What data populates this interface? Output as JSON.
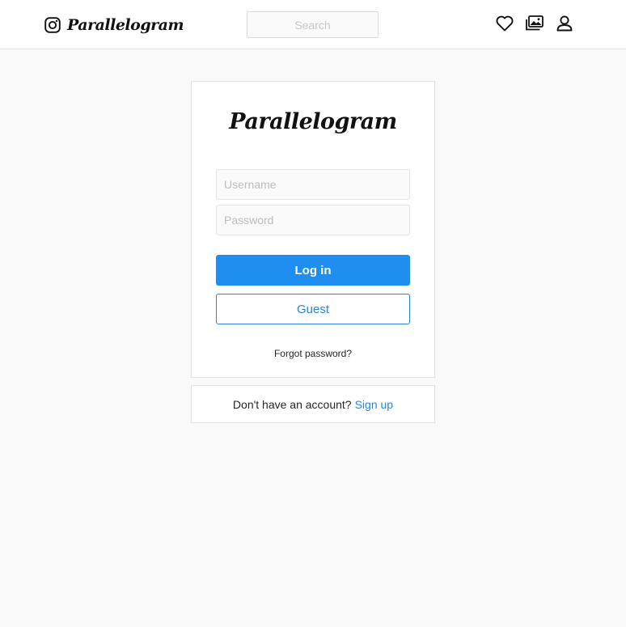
{
  "header": {
    "brand_name": "Parallelogram",
    "search_placeholder": "Search",
    "icons": [
      "camera-icon",
      "heart-icon",
      "photos-icon",
      "user-icon"
    ]
  },
  "login": {
    "logo_text": "Parallelogram",
    "username_placeholder": "Username",
    "password_placeholder": "Password",
    "login_label": "Log in",
    "guest_label": "Guest",
    "forgot_label": "Forgot password?"
  },
  "signup": {
    "prompt": "Don't have an account?",
    "link_label": "Sign up"
  },
  "colors": {
    "primary": "#1e8ff0",
    "link": "#2c84d8",
    "background": "#fafafa"
  }
}
